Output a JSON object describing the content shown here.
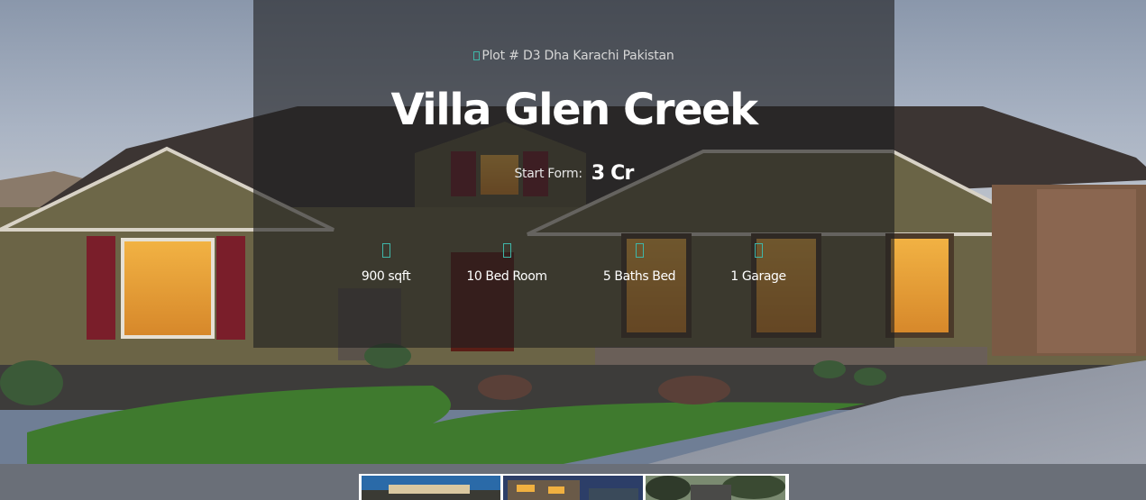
{
  "property": {
    "location": "Plot # D3 Dha Karachi Pakistan",
    "location_icon": "map-marker-icon",
    "title": "Villa Glen Creek",
    "price_label": "Start Form:",
    "price_value": "3 Cr"
  },
  "features": [
    {
      "label": "900 sqft",
      "icon": "area-icon"
    },
    {
      "label": "10 Bed Room",
      "icon": "bed-icon"
    },
    {
      "label": "5 Baths Bed",
      "icon": "bath-icon"
    },
    {
      "label": "1 Garage",
      "icon": "garage-icon"
    }
  ],
  "colors": {
    "accent": "#3fb6a8",
    "overlay": "#1e1e20"
  },
  "gallery": {
    "thumbnails": [
      "thumbnail-1",
      "thumbnail-2",
      "thumbnail-3"
    ]
  }
}
